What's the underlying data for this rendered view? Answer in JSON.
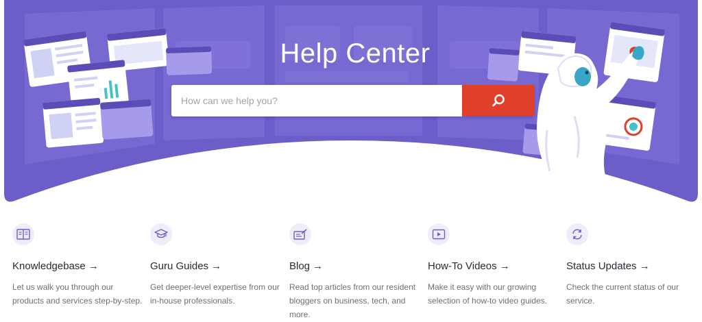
{
  "hero": {
    "title": "Help Center",
    "search_placeholder": "How can we help you?",
    "search_icon": "search-icon",
    "illustration": "yeti-illustration"
  },
  "colors": {
    "hero_bg": "#6c5ec9",
    "hero_panel": "#7f72d6",
    "search_button": "#e0402a",
    "icon_circle": "#eeedf9",
    "icon_stroke": "#6c5ec9"
  },
  "cards": [
    {
      "icon": "book-icon",
      "title": "Knowledgebase",
      "arrow": "→",
      "desc": "Let us walk you through our products and services step-by-step."
    },
    {
      "icon": "graduation-cap-icon",
      "title": "Guru Guides",
      "arrow": "→",
      "desc": "Get deeper-level expertise from our in-house professionals."
    },
    {
      "icon": "blog-pen-icon",
      "title": "Blog",
      "arrow": "→",
      "desc": "Read top articles from our resident bloggers on business, tech, and more."
    },
    {
      "icon": "play-icon",
      "title": "How-To Videos",
      "arrow": "→",
      "desc": "Make it easy with our growing selection of how-to video guides."
    },
    {
      "icon": "refresh-icon",
      "title": "Status Updates",
      "arrow": "→",
      "desc": "Check the current status of our service."
    }
  ]
}
